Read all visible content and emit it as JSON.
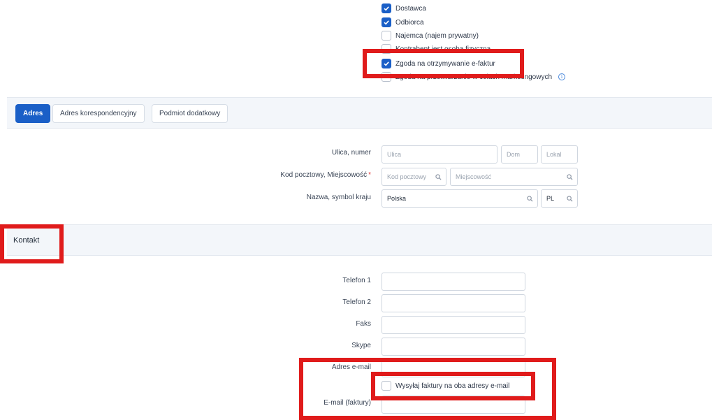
{
  "checkboxes": [
    {
      "label": "Dostawca",
      "checked": true
    },
    {
      "label": "Odbiorca",
      "checked": true
    },
    {
      "label": "Najemca (najem prywatny)",
      "checked": false
    },
    {
      "label": "Kontrahent jest osobą fizyczną",
      "checked": false
    },
    {
      "label": "Zgoda na otrzymywanie e-faktur",
      "checked": true
    },
    {
      "label": "Zgoda na przetwarzanie w celach marketingowych",
      "checked": false,
      "info": "i"
    }
  ],
  "tabs": [
    {
      "label": "Adres",
      "active": true
    },
    {
      "label": "Adres korespondencyjny",
      "active": false
    },
    {
      "label": "Podmiot dodatkowy",
      "active": false
    }
  ],
  "address": {
    "street_label": "Ulica, numer",
    "street_placeholder": "Ulica",
    "house_placeholder": "Dom",
    "flat_placeholder": "Lokal",
    "postal_label": "Kod pocztowy, Miejscowość",
    "required_mark": "*",
    "postal_placeholder": "Kod pocztowy",
    "city_placeholder": "Miejscowość",
    "country_label": "Nazwa, symbol kraju",
    "country_value": "Polska",
    "country_code_value": "PL"
  },
  "contact": {
    "section_title": "Kontakt",
    "phone1_label": "Telefon 1",
    "phone2_label": "Telefon 2",
    "fax_label": "Faks",
    "skype_label": "Skype",
    "email_label": "Adres e-mail",
    "send_both_label": "Wysyłaj faktury na oba adresy e-mail",
    "invoice_email_label": "E-mail (faktury)"
  }
}
